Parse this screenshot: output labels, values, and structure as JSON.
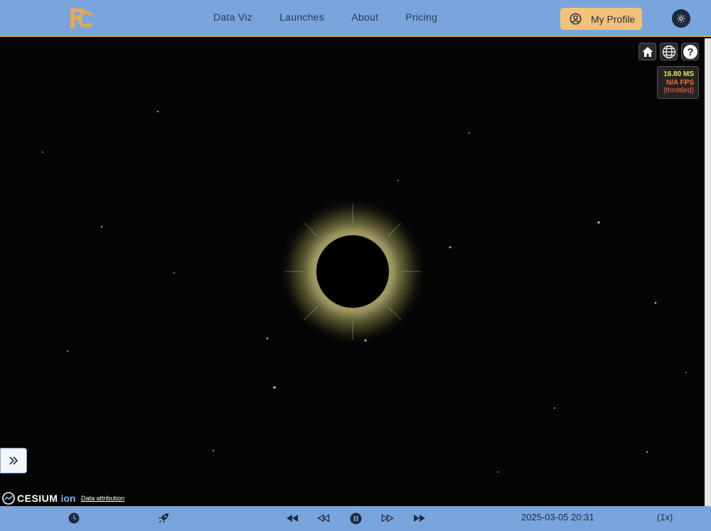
{
  "nav": {
    "links": [
      "Data Viz",
      "Launches",
      "About",
      "Pricing"
    ],
    "profile_label": "My Profile"
  },
  "colors": {
    "navbar": "#7aa5dc",
    "accent": "#f3c27a",
    "logo": "#e9a84b",
    "fps_ms": "#e7e35a",
    "fps_warn": "#ff6a3a"
  },
  "toolbar": {
    "icons": [
      "home-icon",
      "globe-icon",
      "help-icon"
    ]
  },
  "fps": {
    "ms": "16.80 MS",
    "fps": "N/A FPS",
    "note": "(throttled)"
  },
  "viewer": {
    "logo_text": "CESIUM",
    "logo_suffix": "ion",
    "attribution": "Data attribution"
  },
  "playback": {
    "icons": [
      "clock-icon",
      "rocket-icon",
      "skip-back-icon",
      "rewind-icon",
      "pause-icon",
      "fast-forward-icon",
      "skip-forward-icon"
    ],
    "datetime": "2025-03-05 20:31",
    "speed": "(1x)"
  }
}
